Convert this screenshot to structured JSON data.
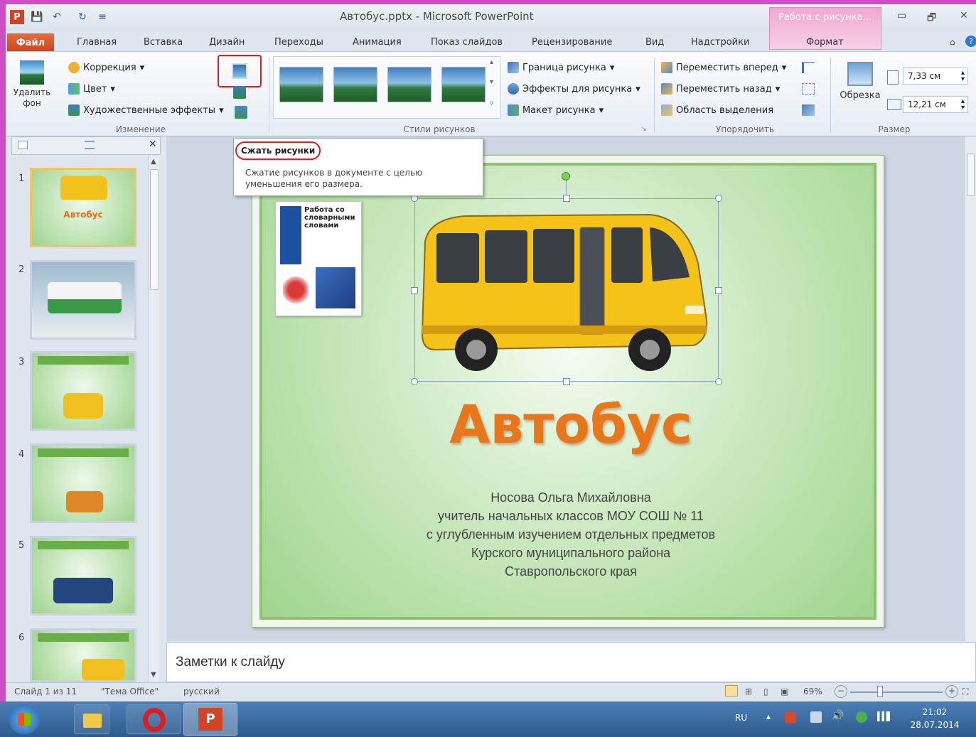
{
  "window_title": "Автобус.pptx - Microsoft PowerPoint",
  "context_tab_group": "Работа с рисунка...",
  "tabs": [
    "Файл",
    "Главная",
    "Вставка",
    "Дизайн",
    "Переходы",
    "Анимация",
    "Показ слайдов",
    "Рецензирование",
    "Вид",
    "Надстройки",
    "Формат"
  ],
  "ribbon": {
    "remove_bg": "Удалить фон",
    "correction": "Коррекция",
    "color": "Цвет",
    "artistic": "Художественные эффекты",
    "group_change": "Изменение",
    "border": "Граница рисунка",
    "effects": "Эффекты для рисунка",
    "layout": "Макет рисунка",
    "group_styles": "Стили рисунков",
    "bring_forward": "Переместить вперед",
    "send_backward": "Переместить назад",
    "selection_pane": "Область выделения",
    "group_arrange": "Упорядочить",
    "crop": "Обрезка",
    "height": "7,33 см",
    "width": "12,21 см",
    "group_size": "Размер"
  },
  "tooltip": {
    "title": "Сжать рисунки",
    "text": "Сжатие рисунков в документе с целью уменьшения его размера."
  },
  "thumbnails": [
    {
      "num": "1",
      "title": "Автобус"
    },
    {
      "num": "2",
      "title": ""
    },
    {
      "num": "3",
      "title": ""
    },
    {
      "num": "4",
      "title": ""
    },
    {
      "num": "5",
      "title": ""
    },
    {
      "num": "6",
      "title": ""
    }
  ],
  "slide": {
    "book_title": "Работа со словарными словами",
    "title": "Автобус",
    "lines": [
      "Носова Ольга Михайловна",
      "учитель начальных классов МОУ СОШ № 11",
      "с углубленным изучением отдельных предметов",
      "Курского муниципального района",
      "Ставропольского края"
    ]
  },
  "notes_placeholder": "Заметки к слайду",
  "status": {
    "slide": "Слайд 1 из 11",
    "theme": "\"Тема Office\"",
    "lang": "русский",
    "zoom": "69%"
  },
  "taskbar": {
    "lang": "RU",
    "time": "21:02",
    "date": "28.07.2014"
  }
}
